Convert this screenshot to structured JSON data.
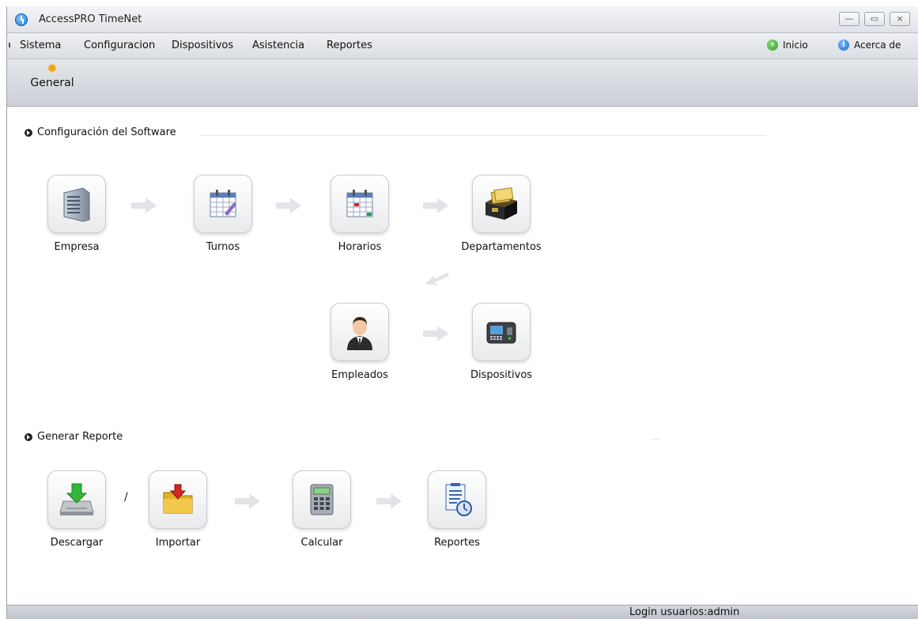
{
  "window": {
    "title": "AccessPRO TimeNet"
  },
  "window_controls": {
    "minimize": "—",
    "maximize": "▭",
    "close": "×"
  },
  "menu": {
    "items": [
      "Sistema",
      "Configuracion",
      "Dispositivos",
      "Asistencia",
      "Reportes"
    ],
    "right": {
      "home": "Inicio",
      "about": "Acerca de"
    }
  },
  "toolbar": {
    "general": "General"
  },
  "config": {
    "title": "Configuración del Software",
    "items": {
      "empresa": "Empresa",
      "turnos": "Turnos",
      "horarios": "Horarios",
      "departamentos": "Departamentos",
      "empleados": "Empleados",
      "dispositivos": "Dispositivos"
    }
  },
  "report": {
    "title": "Generar Reporte",
    "separator": "/",
    "items": {
      "descargar": "Descargar",
      "importar": "Importar",
      "calcular": "Calcular",
      "reportes": "Reportes"
    }
  },
  "status": {
    "login": "Login usuarios:admin"
  }
}
